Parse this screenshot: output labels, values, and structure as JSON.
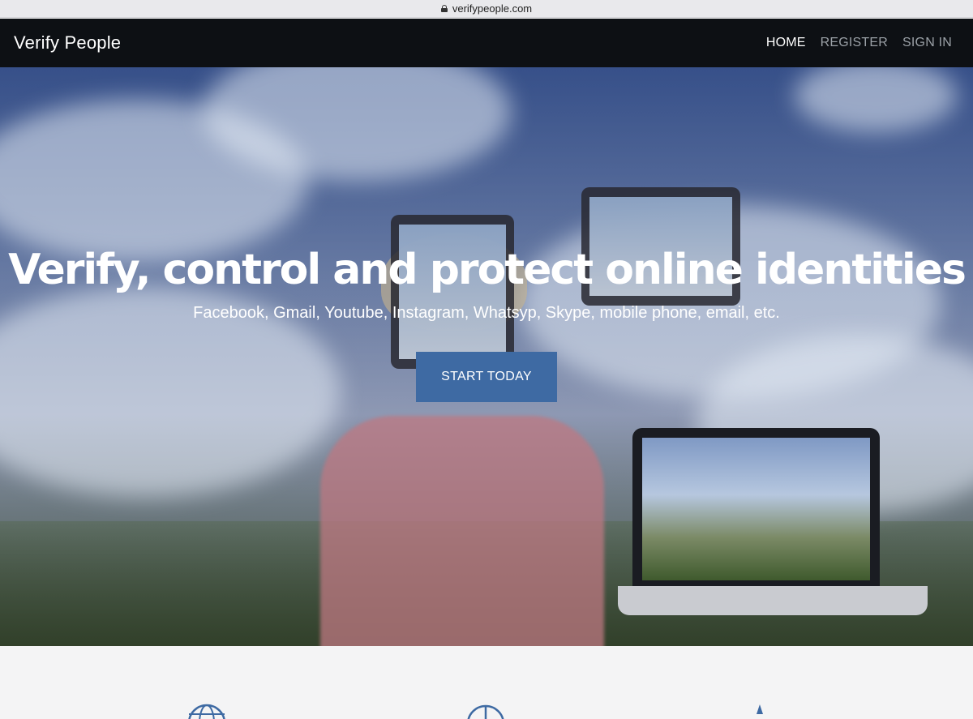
{
  "browser": {
    "url": "verifypeople.com"
  },
  "navbar": {
    "brand": "Verify People",
    "links": [
      {
        "label": "HOME",
        "active": true
      },
      {
        "label": "REGISTER",
        "active": false
      },
      {
        "label": "SIGN IN",
        "active": false
      }
    ]
  },
  "hero": {
    "headline": "Verify, control and protect online identities",
    "subheadline": "Facebook, Gmail, Youtube, Instagram, Whatsyp, Skype, mobile phone, email, etc.",
    "cta_label": "START TODAY"
  },
  "features": {
    "icons": [
      "globe-icon",
      "pie-chart-icon",
      "rocket-icon"
    ]
  },
  "colors": {
    "navbar_bg": "#0d1014",
    "cta_bg": "#3e6aa3",
    "icon_stroke": "#3e6aa3",
    "section_bg": "#f4f4f5"
  }
}
